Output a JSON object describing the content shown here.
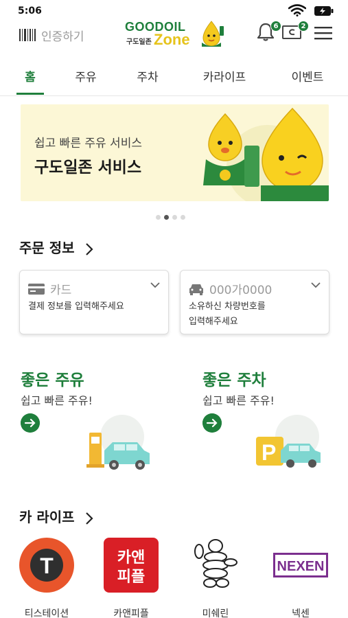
{
  "status_bar": {
    "time": "5:06"
  },
  "header": {
    "auth_label": "인증하기",
    "logo": {
      "brand": "GOODOIL",
      "sub": "구도일존",
      "zone": "Zone"
    },
    "notification_count": "6",
    "coupon_count": "2",
    "colors": {
      "brand_green": "#1f7f3c",
      "brand_yellow": "#e6c31b"
    }
  },
  "tabs": [
    {
      "label": "홈",
      "active": true
    },
    {
      "label": "주유"
    },
    {
      "label": "주차"
    },
    {
      "label": "카라이프"
    },
    {
      "label": "이벤트"
    }
  ],
  "banner": {
    "subtitle": "쉽고 빠른 주유 서비스",
    "title": "구도일존 서비스",
    "slides": 4,
    "active_slide": 2
  },
  "order_info": {
    "title": "주문 정보",
    "card": {
      "label": "카드",
      "desc": "결제 정보를 입력해주세요",
      "icon": "credit-card-icon"
    },
    "car": {
      "label": "000가0000",
      "desc_line1": "소유하신 차량번호를",
      "desc_line2": "입력해주세요",
      "icon": "car-icon"
    }
  },
  "promos": [
    {
      "title": "좋은 주유",
      "subtitle": "쉽고 빠른 주유!",
      "icon": "arrow-right-icon"
    },
    {
      "title": "좋은 주차",
      "subtitle": "쉽고 빠른 주유!",
      "icon": "arrow-right-icon"
    }
  ],
  "car_life": {
    "title": "카 라이프",
    "partners": [
      {
        "label": "티스테이션",
        "logo_text": "T"
      },
      {
        "label": "카앤피플",
        "logo_text": "카앤피플"
      },
      {
        "label": "미쉐린",
        "logo_text": ""
      },
      {
        "label": "넥센",
        "logo_text": "NEXEN"
      }
    ]
  }
}
